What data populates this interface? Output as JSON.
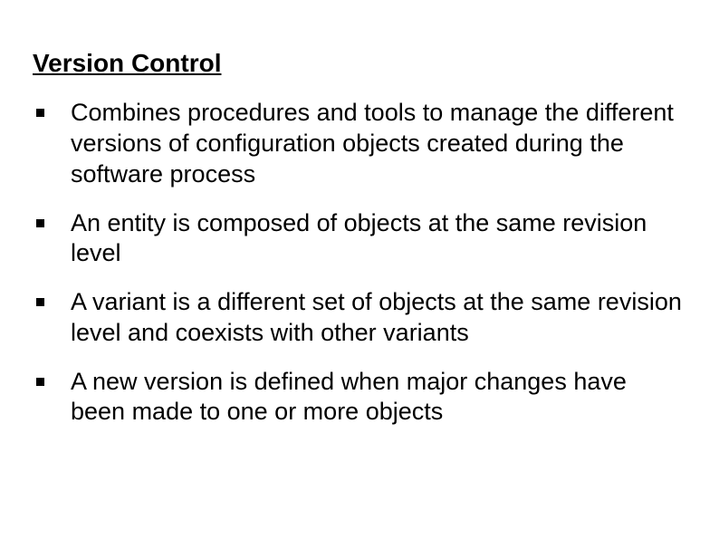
{
  "title": "Version Control",
  "bullets": [
    "Combines procedures and tools to manage the different versions of configuration objects created during the software process",
    "An entity is composed of objects at the same revision level",
    "A variant is a different set of objects at the same revision level and coexists with other variants",
    "A new version is defined when major changes have been made to one or more objects"
  ]
}
